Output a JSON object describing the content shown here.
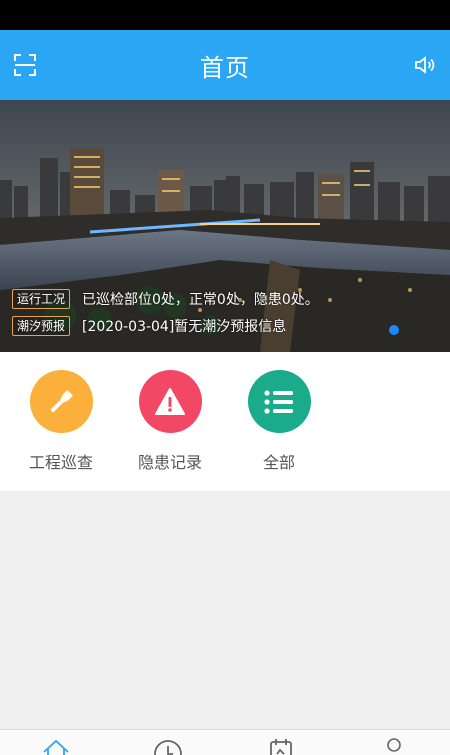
{
  "header": {
    "title": "首页"
  },
  "banner": {
    "ticker_1": {
      "tag": "运行工况",
      "message": "已巡检部位0处，正常0处，隐患0处。"
    },
    "ticker_2": {
      "tag": "潮汐预报",
      "message": "[2020-03-04]暂无潮汐预报信息"
    }
  },
  "menu": {
    "items": [
      {
        "label": "工程巡查",
        "icon": "flashlight-icon",
        "color": "#fbb03b"
      },
      {
        "label": "隐患记录",
        "icon": "warning-icon",
        "color": "#f24866"
      },
      {
        "label": "全部",
        "icon": "list-icon",
        "color": "#1aab8a"
      }
    ]
  },
  "colors": {
    "header": "#2ba6f4",
    "indicator": "#1e88ff"
  },
  "tabbar": {
    "icons": [
      "home-icon",
      "clock-icon",
      "calendar-icon",
      "profile-icon"
    ]
  }
}
